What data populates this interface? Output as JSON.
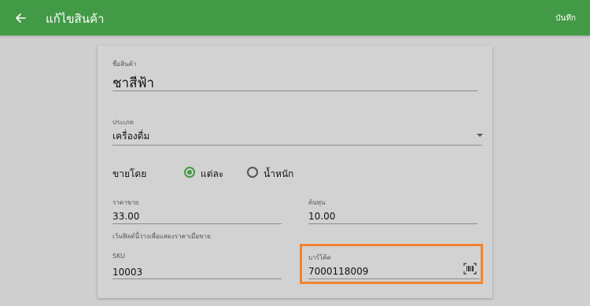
{
  "header": {
    "title": "แก้ไขสินค้า",
    "save_label": "บันทึก",
    "back_icon": "arrow-back-icon",
    "bar_color": "#439a46"
  },
  "form": {
    "name": {
      "label": "ชื่อสินค้า",
      "value": "ชาสีฟ้า"
    },
    "category": {
      "label": "ประเภท",
      "value": "เครื่องดื่ม"
    },
    "sell_by": {
      "label": "ขายโดย",
      "options": [
        {
          "label": "แต่ละ",
          "selected": true
        },
        {
          "label": "น้ำหนัก",
          "selected": false
        }
      ]
    },
    "price": {
      "label": "ราคาขาย",
      "value": "33.00"
    },
    "cost": {
      "label": "ต้นทุน",
      "value": "10.00"
    },
    "price_hint": "เว้นฟิลด์นี้ว่างเพื่อแสดงราคาเมื่อขาย",
    "sku": {
      "label": "SKU",
      "value": "10003"
    },
    "barcode": {
      "label": "บาร์โค้ด",
      "value": "7000118009",
      "icon": "barcode-scan-icon"
    }
  },
  "colors": {
    "accent": "#439a46",
    "highlight": "#ef8430"
  }
}
